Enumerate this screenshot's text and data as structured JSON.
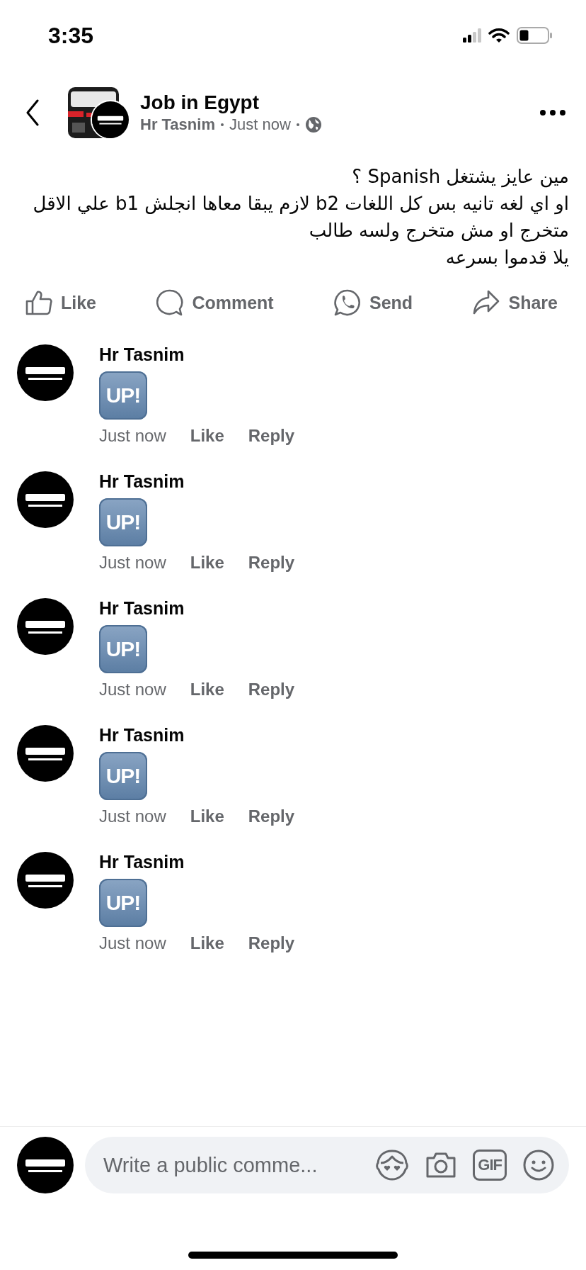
{
  "status_bar": {
    "time": "3:35"
  },
  "post": {
    "group": "Job in Egypt",
    "author": "Hr Tasnim",
    "time": "Just now",
    "lines": [
      "مين عايز يشتغل Spanish ؟",
      "او اي لغه تانيه بس كل اللغات b2 لازم يبقا معاها انجلش b1 علي الاقل",
      "متخرج او مش متخرج ولسه طالب",
      "يلا قدموا بسرعه"
    ]
  },
  "actions": [
    {
      "kind": "like",
      "label": "Like"
    },
    {
      "kind": "comment",
      "label": "Comment"
    },
    {
      "kind": "send",
      "label": "Send"
    },
    {
      "kind": "share",
      "label": "Share"
    }
  ],
  "comments": [
    {
      "author": "Hr Tasnim",
      "sticker": "UP!",
      "time": "Just now",
      "like": "Like",
      "reply": "Reply"
    },
    {
      "author": "Hr Tasnim",
      "sticker": "UP!",
      "time": "Just now",
      "like": "Like",
      "reply": "Reply"
    },
    {
      "author": "Hr Tasnim",
      "sticker": "UP!",
      "time": "Just now",
      "like": "Like",
      "reply": "Reply"
    },
    {
      "author": "Hr Tasnim",
      "sticker": "UP!",
      "time": "Just now",
      "like": "Like",
      "reply": "Reply"
    },
    {
      "author": "Hr Tasnim",
      "sticker": "UP!",
      "time": "Just now",
      "like": "Like",
      "reply": "Reply"
    }
  ],
  "composer": {
    "placeholder": "Write a public comme...",
    "tools": [
      {
        "kind": "avatar"
      },
      {
        "kind": "camera"
      },
      {
        "kind": "gif",
        "label": "GIF"
      },
      {
        "kind": "emoji"
      }
    ]
  }
}
